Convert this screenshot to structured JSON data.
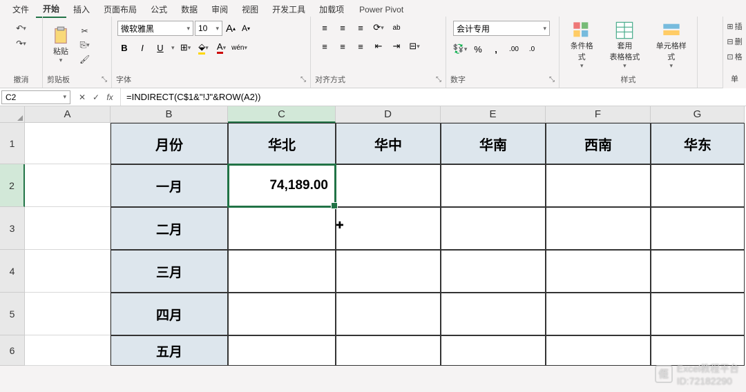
{
  "menu": {
    "items": [
      "文件",
      "开始",
      "插入",
      "页面布局",
      "公式",
      "数据",
      "审阅",
      "视图",
      "开发工具",
      "加载项"
    ],
    "brand": "Power Pivot",
    "active": 1
  },
  "ribbon": {
    "undo": "撤消",
    "clipboard": {
      "label": "剪贴板",
      "paste": "粘贴"
    },
    "font": {
      "label": "字体",
      "name": "微软雅黑",
      "size": "10",
      "inc": "A",
      "dec": "A",
      "bold": "B",
      "italic": "I",
      "underline": "U"
    },
    "align": {
      "label": "对齐方式",
      "wrap": "ab"
    },
    "number": {
      "label": "数字",
      "format": "会计专用",
      "percent": "%",
      "comma": ","
    },
    "styles": {
      "label": "样式",
      "cond": "条件格式",
      "table": "套用\n表格格式",
      "cell": "单元格样式"
    },
    "side": [
      "插",
      "删",
      "格"
    ],
    "cell_group": "单"
  },
  "formula": {
    "cell": "C2",
    "fx": "fx",
    "value": "=INDIRECT(C$1&\"!J\"&ROW(A2))"
  },
  "grid": {
    "cols": [
      "A",
      "B",
      "C",
      "D",
      "E",
      "F",
      "G"
    ],
    "rows": [
      "1",
      "2",
      "3",
      "4",
      "5",
      "6"
    ],
    "headers": {
      "B": "月份",
      "C": "华北",
      "D": "华中",
      "E": "华南",
      "F": "西南",
      "G": "华东"
    },
    "months": [
      "一月",
      "二月",
      "三月",
      "四月",
      "五月"
    ],
    "c2": "74,189.00"
  },
  "watermark": {
    "line1": "Excel教程平台",
    "line2": "ID:72182290",
    "logo": "佢"
  }
}
